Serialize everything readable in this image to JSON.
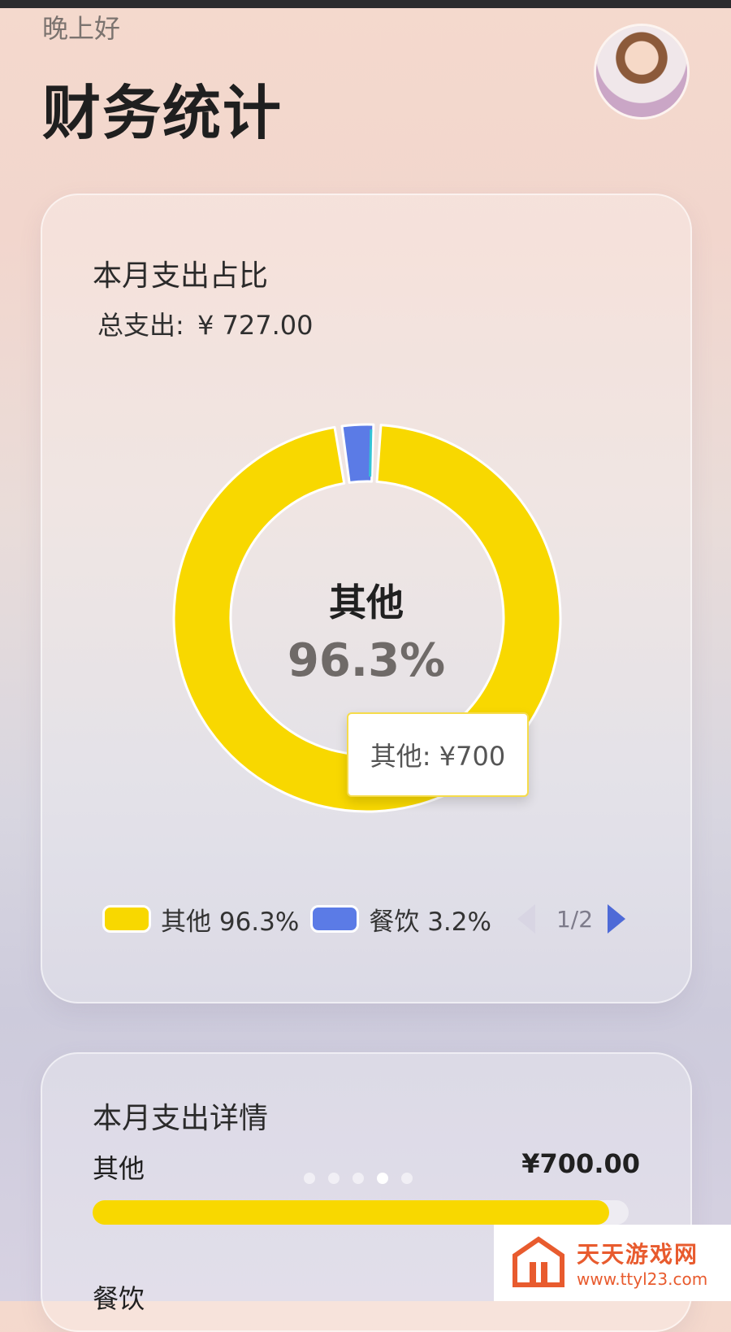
{
  "header": {
    "greeting": "晚上好",
    "title": "财务统计"
  },
  "expense_ratio_card": {
    "title": "本月支出占比",
    "total_label": "总支出:",
    "total_value": "¥ 727.00",
    "center_label": "其他",
    "center_value": "96.3%",
    "tooltip": "其他: ¥700",
    "legend": [
      {
        "label": "其他 96.3%",
        "color": "#f8d800"
      },
      {
        "label": "餐饮 3.2%",
        "color": "#5b7be6"
      }
    ],
    "pagination": "1/2"
  },
  "chart_data": {
    "type": "pie",
    "categories": [
      "其他",
      "餐饮"
    ],
    "values": [
      96.3,
      3.2
    ],
    "colors": [
      "#f8d800",
      "#5b7be6"
    ],
    "title": "本月支出占比"
  },
  "expense_detail_card": {
    "title": "本月支出详情",
    "rows": [
      {
        "label": "其他",
        "amount": "¥700.00",
        "progress": 0.963
      }
    ],
    "next_item": "餐饮",
    "dots_count": 5,
    "active_dot": 3
  },
  "watermark": {
    "name": "天天游戏网",
    "url": "www.ttyl23.com"
  }
}
